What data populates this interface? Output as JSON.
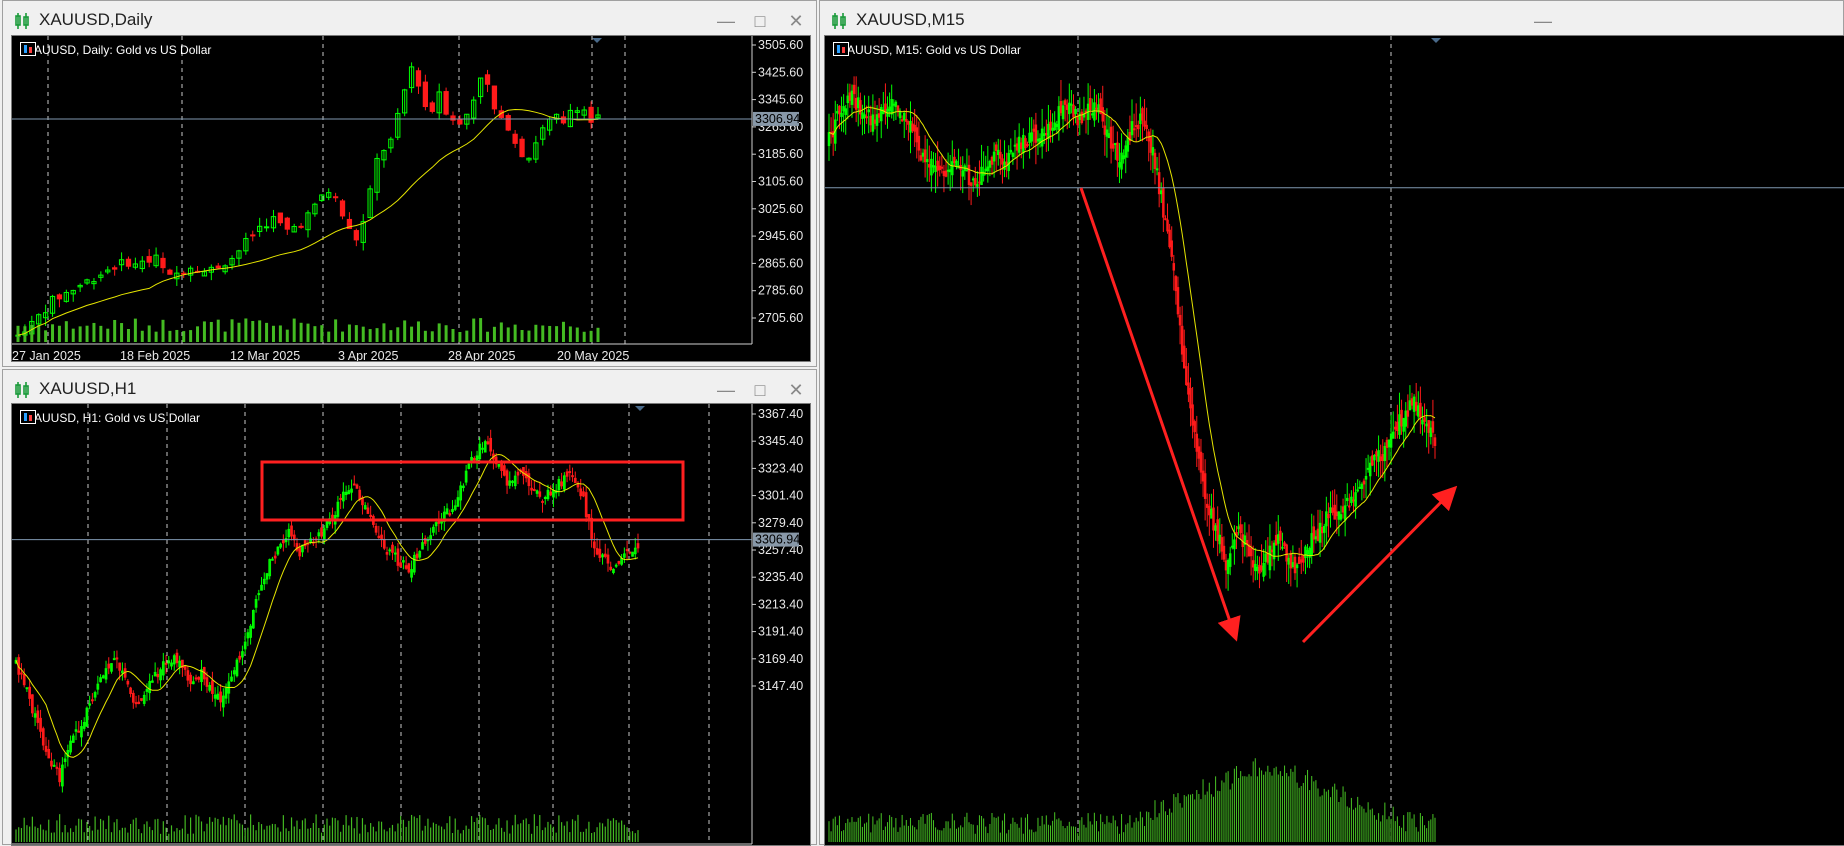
{
  "colors": {
    "bull": "#00ff00",
    "bear": "#ff1a1a",
    "ma": "#e6e600",
    "volume": "#44bb22",
    "grid": "#c8c8c8",
    "price_line": "#7f97b0",
    "annotation": "#ff2020",
    "chart_bg": "#000000"
  },
  "windows": {
    "daily": {
      "title": "XAUUSD,Daily",
      "header_text": "XAUUSD, Daily:  Gold vs US Dollar",
      "price_tag": "3306.94",
      "price_levels": [
        "3505.60",
        "3425.60",
        "3345.60",
        "3265.60",
        "3185.60",
        "3105.60",
        "3025.60",
        "2945.60",
        "2865.60",
        "2785.60",
        "2705.60"
      ],
      "date_labels": [
        "27 Jan 2025",
        "18 Feb 2025",
        "12 Mar 2025",
        "3 Apr 2025",
        "28 Apr 2025",
        "20 May 2025"
      ]
    },
    "h1": {
      "title": "XAUUSD,H1",
      "header_text": "XAUUSD, H1:  Gold vs US Dollar",
      "price_tag": "3306.94",
      "price_levels": [
        "3367.40",
        "3345.40",
        "3323.40",
        "3301.40",
        "3279.40",
        "3257.40",
        "3235.40",
        "3213.40",
        "3191.40",
        "3169.40",
        "3147.40"
      ]
    },
    "m15": {
      "title": "XAUUSD,M15",
      "header_text": "XAUUSD, M15:  Gold vs US Dollar"
    }
  },
  "chart_data": [
    {
      "type": "candlestick",
      "symbol": "XAUUSD",
      "timeframe": "Daily",
      "ylim": [
        2680,
        3520
      ],
      "current_price": 3306.94,
      "series": [
        {
          "name": "close_approx",
          "values": [
            2750,
            2770,
            2780,
            2800,
            2820,
            2840,
            2850,
            2860,
            2870,
            2880,
            2890,
            2900,
            2910,
            2920,
            2930,
            2935,
            2940,
            2930,
            2945,
            2940,
            2950,
            2920,
            2900,
            2910,
            2920,
            2930,
            2925,
            2915,
            2920,
            2930,
            2940,
            2950,
            2970,
            2990,
            3010,
            3030,
            3040,
            3050,
            3035,
            3020,
            3030,
            3040,
            3060,
            3080,
            3110,
            3120,
            3100,
            3060,
            3020,
            3000,
            3040,
            3120,
            3200,
            3230,
            3250,
            3310,
            3380,
            3440,
            3400,
            3340,
            3330,
            3380,
            3330,
            3310,
            3290,
            3320,
            3360,
            3420,
            3390,
            3330,
            3300,
            3290,
            3250,
            3220,
            3210,
            3250,
            3280,
            3300,
            3310,
            3290,
            3330,
            3340,
            3330,
            3300,
            3310
          ]
        }
      ]
    },
    {
      "type": "candlestick",
      "symbol": "XAUUSD",
      "timeframe": "H1",
      "ylim": [
        3130,
        3385
      ],
      "current_price": 3306.94,
      "series": [
        {
          "name": "close_approx",
          "values": [
            3235,
            3220,
            3200,
            3180,
            3170,
            3190,
            3200,
            3215,
            3230,
            3240,
            3225,
            3210,
            3220,
            3230,
            3240,
            3235,
            3225,
            3230,
            3220,
            3215,
            3230,
            3250,
            3270,
            3290,
            3300,
            3310,
            3300,
            3305,
            3310,
            3320,
            3335,
            3340,
            3325,
            3310,
            3300,
            3295,
            3290,
            3300,
            3310,
            3320,
            3325,
            3340,
            3355,
            3365,
            3350,
            3340,
            3345,
            3340,
            3330,
            3335,
            3340,
            3345,
            3330,
            3300,
            3295,
            3290,
            3300,
            3305
          ]
        }
      ]
    },
    {
      "type": "candlestick",
      "symbol": "XAUUSD",
      "timeframe": "M15",
      "current_price": 3306.94,
      "series": [
        {
          "name": "close_approx",
          "values": [
            3322,
            3330,
            3336,
            3332,
            3328,
            3330,
            3334,
            3330,
            3326,
            3316,
            3314,
            3310,
            3316,
            3312,
            3308,
            3314,
            3318,
            3316,
            3320,
            3322,
            3324,
            3326,
            3330,
            3332,
            3328,
            3332,
            3330,
            3320,
            3316,
            3326,
            3328,
            3318,
            3300,
            3280,
            3250,
            3230,
            3210,
            3200,
            3190,
            3200,
            3195,
            3188,
            3192,
            3198,
            3190,
            3188,
            3196,
            3200,
            3206,
            3204,
            3210,
            3216,
            3220,
            3224,
            3230,
            3236,
            3240,
            3234,
            3228
          ]
        }
      ]
    }
  ]
}
